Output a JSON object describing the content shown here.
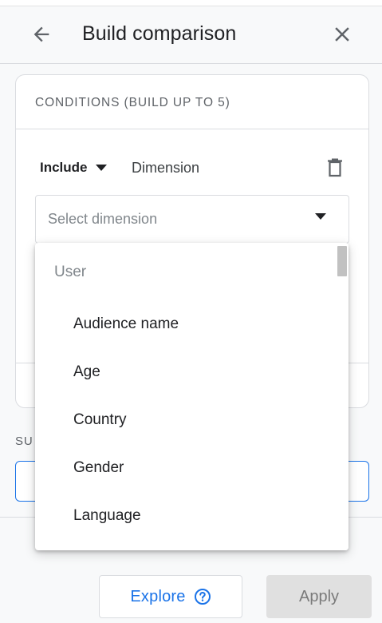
{
  "header": {
    "title": "Build comparison",
    "back_icon": "arrow-back-icon",
    "close_icon": "close-icon"
  },
  "conditions": {
    "heading": "CONDITIONS (BUILD UP TO 5)",
    "include_label": "Include",
    "dimension_label": "Dimension",
    "select_placeholder": "Select dimension"
  },
  "summary": {
    "label_partial": "SU"
  },
  "dropdown": {
    "group_label": "User",
    "items": [
      "Audience name",
      "Age",
      "Country",
      "Gender",
      "Language"
    ]
  },
  "footer": {
    "explore_label": "Explore",
    "apply_label": "Apply"
  },
  "colors": {
    "accent": "#1a73e8",
    "disabled_bg": "#e0e0e0",
    "error_dot": "#d93025"
  }
}
